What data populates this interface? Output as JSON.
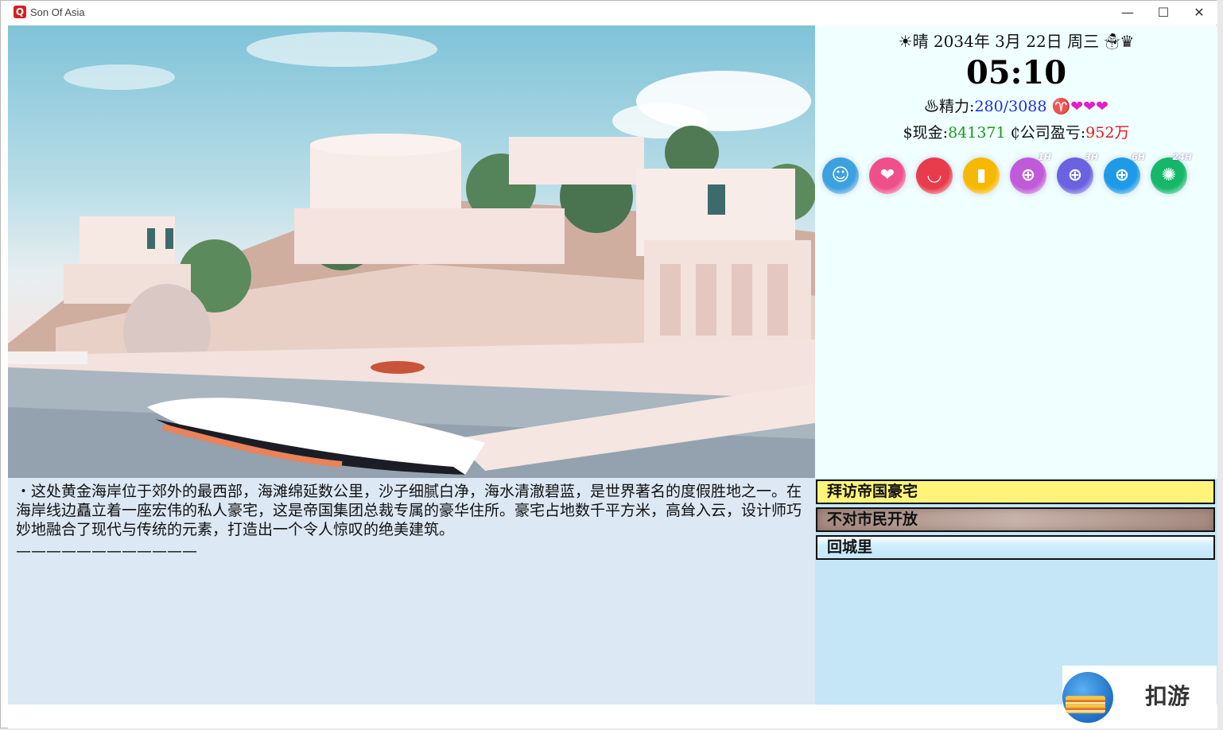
{
  "window": {
    "title": "Son Of Asia",
    "app_icon_glyph": "Q",
    "controls": {
      "minimize": "—",
      "maximize": "☐",
      "close": "✕"
    }
  },
  "status": {
    "weather_icon": "☀",
    "weather": "晴",
    "date": "2034年 3月 22日 周三",
    "date_suffix_icons": "☃♛",
    "time": "05:10",
    "energy_icon": "♨",
    "energy_label": "精力:",
    "energy_value": "280/3088",
    "zodiac_and_hearts": "♈❤❤❤",
    "cash_symbol": "$",
    "cash_label": "现金:",
    "cash_value": "841371",
    "company_symbol": "₵",
    "company_label": "公司盈亏:",
    "company_value": "952万"
  },
  "toolbar": {
    "icons": [
      {
        "name": "contacts-icon",
        "glyph": "☺",
        "color": "#3da0e0",
        "tag": ""
      },
      {
        "name": "relationship-heart-icon",
        "glyph": "❤",
        "color": "#f0508a",
        "tag": ""
      },
      {
        "name": "shopping-bag-icon",
        "glyph": "◡",
        "color": "#e83c4c",
        "tag": ""
      },
      {
        "name": "inventory-icon",
        "glyph": "▮",
        "color": "#f6b800",
        "tag": ""
      },
      {
        "name": "wait-1h-icon",
        "glyph": "⊕",
        "color": "#c05ad8",
        "tag": "1H"
      },
      {
        "name": "wait-3h-icon",
        "glyph": "⊕",
        "color": "#6a62e0",
        "tag": "3H"
      },
      {
        "name": "wait-6h-icon",
        "glyph": "⊕",
        "color": "#1e9be8",
        "tag": "6H"
      },
      {
        "name": "wait-24h-icon",
        "glyph": "✺",
        "color": "#14b868",
        "tag": "24H"
      }
    ]
  },
  "description": {
    "text": "・这处黄金海岸位于郊外的最西部，海滩绵延数公里，沙子细腻白净，海水清澈碧蓝，是世界著名的度假胜地之一。在海岸线边矗立着一座宏伟的私人豪宅，这是帝国集团总裁专属的豪华住所。豪宅占地数千平方米，高耸入云，设计师巧妙地融合了现代与传统的元素，打造出一个令人惊叹的绝美建筑。",
    "divider": "————————————"
  },
  "actions": {
    "visit": "拜访帝国豪宅",
    "closed": "不对市民开放",
    "back": "回城里"
  },
  "watermark": {
    "text": "扣游"
  }
}
